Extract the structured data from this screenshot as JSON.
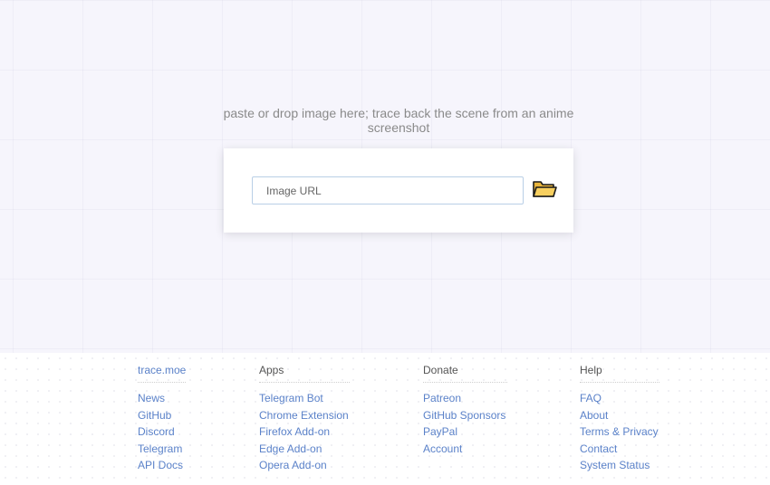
{
  "hero": {
    "tagline": "paste or drop image here; trace back the scene from an anime screenshot",
    "input_placeholder": "Image URL",
    "folder_icon": "folder-icon"
  },
  "footer": {
    "columns": [
      {
        "title": "trace.moe",
        "links": [
          "News",
          "GitHub",
          "Discord",
          "Telegram",
          "API Docs"
        ]
      },
      {
        "title": "Apps",
        "links": [
          "Telegram Bot",
          "Chrome Extension",
          "Firefox Add-on",
          "Edge Add-on",
          "Opera Add-on"
        ]
      },
      {
        "title": "Donate",
        "links": [
          "Patreon",
          "GitHub Sponsors",
          "PayPal",
          "Account"
        ]
      },
      {
        "title": "Help",
        "links": [
          "FAQ",
          "About",
          "Terms & Privacy",
          "Contact",
          "System Status"
        ]
      }
    ]
  },
  "colors": {
    "link": "#5b82c9",
    "background": "#f6f5fc",
    "input_border": "#b9cfe6",
    "folder_fill": "#f5c24a"
  }
}
